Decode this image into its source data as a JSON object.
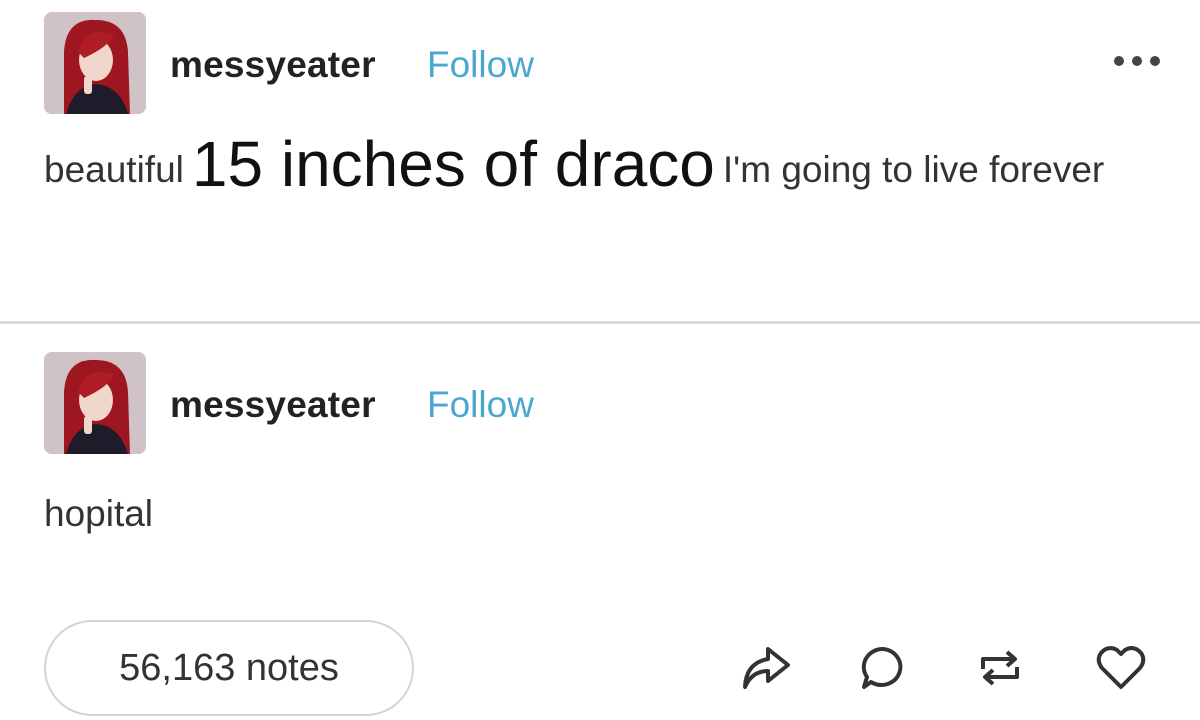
{
  "posts": [
    {
      "username": "messyeater",
      "follow_label": "Follow",
      "text_before": "beautiful",
      "text_big": "15 inches of draco",
      "text_after": "I'm going to live forever"
    },
    {
      "username": "messyeater",
      "follow_label": "Follow",
      "text": "hopital"
    }
  ],
  "footer": {
    "notes_label": "56,163 notes",
    "actions": [
      "share-icon",
      "reply-icon",
      "reblog-icon",
      "like-icon"
    ]
  },
  "colors": {
    "follow": "#4aa8d0",
    "text": "#333333",
    "divider": "#d9d9d9"
  }
}
